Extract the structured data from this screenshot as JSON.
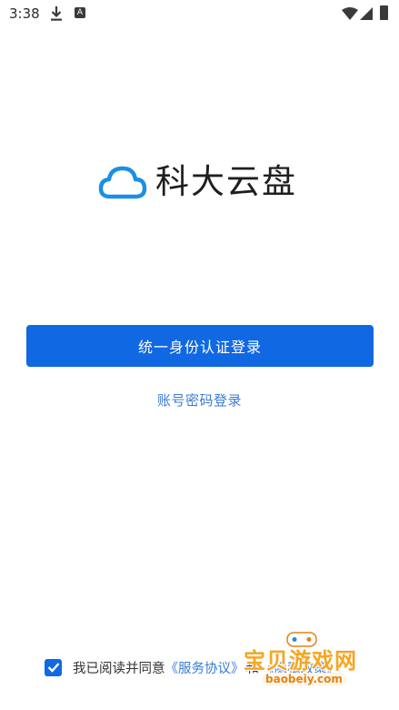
{
  "status_bar": {
    "time": "3:38",
    "app_icon_label": "A"
  },
  "logo": {
    "title": "科大云盘",
    "icon": "cloud-icon",
    "color": "#1a8fe3"
  },
  "login": {
    "primary_button": "统一身份认证登录",
    "account_link": "账号密码登录"
  },
  "agreement": {
    "checked": true,
    "text": "我已阅读并同意",
    "service_link": "《服务协议》",
    "and": "和",
    "privacy_link": "《隐私政策》"
  },
  "watermark": {
    "title": "宝贝游戏网",
    "url": "baobeiy.com"
  },
  "colors": {
    "primary": "#1168e3",
    "link": "#3a7bd5",
    "text": "#333333"
  }
}
